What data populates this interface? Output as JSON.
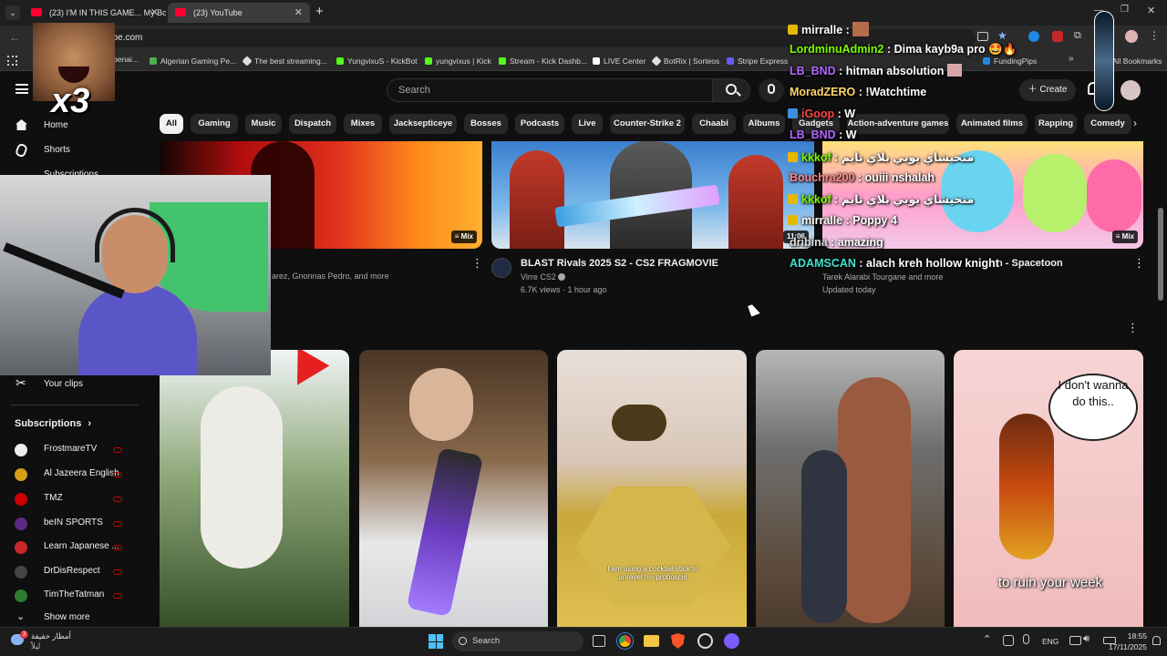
{
  "browser": {
    "tabs": [
      {
        "label": "(23) I'M IN THIS GAME... My Bo",
        "active": false
      },
      {
        "label": "(23) YouTube",
        "active": true
      }
    ],
    "new_tab": "+",
    "url": "ube.com",
    "bookmarks": [
      {
        "label": "Algerian Gaming Pe...",
        "color": "#4caf50"
      },
      {
        "label": "The best streaming...",
        "color": "#dddddd"
      },
      {
        "label": "YungvixuS - KickBot",
        "color": "#53fc18"
      },
      {
        "label": "yungvixus | Kick",
        "color": "#53fc18"
      },
      {
        "label": "Stream - Kick Dashb...",
        "color": "#53fc18"
      },
      {
        "label": "LIVE Center",
        "color": "#ffffff"
      },
      {
        "label": "BotRix | Sorteos",
        "color": "#e0e0e0"
      },
      {
        "label": "Stripe Express",
        "color": "#635bff"
      },
      {
        "label": "FundingPips",
        "color": "#1e88e5"
      },
      {
        "label": "All Bookmarks",
        "color": "#888888"
      }
    ],
    "bm_partial": "benai..."
  },
  "youtube": {
    "search_placeholder": "Search",
    "create_label": "Create",
    "chips": [
      "All",
      "Gaming",
      "Music",
      "Dispatch",
      "Mixes",
      "Jacksepticeye",
      "Bosses",
      "Podcasts",
      "Live",
      "Counter-Strike 2",
      "Chaabi",
      "Albums",
      "Gadgets",
      "Action-adventure games",
      "Animated films",
      "Rapping",
      "Comedy"
    ],
    "sidebar": {
      "home": "Home",
      "shorts": "Shorts",
      "subscriptions_top": "Subscriptions",
      "your_clips": "Your clips",
      "subscriptions_header": "Subscriptions",
      "channels": [
        {
          "name": "FrostmareTV",
          "color": "#eeeeee"
        },
        {
          "name": "Al Jazeera English",
          "color": "#d4a017"
        },
        {
          "name": "TMZ",
          "color": "#cc0000"
        },
        {
          "name": "beIN SPORTS",
          "color": "#5b2a86"
        },
        {
          "name": "Learn Japanese ...",
          "color": "#c62828"
        },
        {
          "name": "DrDisRespect",
          "color": "#444444"
        },
        {
          "name": "TimTheTatman",
          "color": "#2e7d32"
        }
      ],
      "show_more": "Show more"
    },
    "videos_row1": [
      {
        "badge": "Mix",
        "meta": "arez, Gnonnas Pedro, and more"
      },
      {
        "title": "BLAST Rivals 2025 S2 - CS2 FRAGMOVIE",
        "channel": "Virre CS2",
        "views": "6.7K views · 1 hour ago",
        "duration": "11:06"
      },
      {
        "badge": "Mix",
        "title_tail": "n - Spacetoon",
        "meta": "Tarek Alarabi Tourgane and more",
        "updated": "Updated today"
      }
    ],
    "shorts": [
      {
        "caption": ""
      },
      {
        "caption": ""
      },
      {
        "caption": "I am using a cocktail stick to unravel his proboscis"
      },
      {
        "caption": ""
      },
      {
        "caption": "to ruin your week",
        "bubble": "I don't wanna do this.."
      }
    ]
  },
  "chat": [
    {
      "user": "mirralle",
      "msg": " : ",
      "color": "#ffffff",
      "badge": true
    },
    {
      "user": "LordminuAdmin2",
      "msg": " : Dima kayb9a pro",
      "color": "#7cfc00",
      "badge": false
    },
    {
      "user": "LB_BND",
      "msg": " : hitman absolution",
      "color": "#b266ff",
      "badge": false
    },
    {
      "user": "MoradZERO",
      "msg": " : !Watchtime",
      "color": "#ffd966",
      "badge": false
    },
    {
      "user": "iGoop",
      "msg": " : W",
      "color": "#ff4444",
      "badge": true
    },
    {
      "user": "LB_BND",
      "msg": " : W",
      "color": "#b266ff",
      "badge": false
    },
    {
      "user": "kkkof",
      "msg": " : متحيشاي يوبي بلاي تايم",
      "color": "#7cfc00",
      "badge": true
    },
    {
      "user": "Bouchra200",
      "msg": " : ouiii nshalah",
      "color": "#ff8a8a",
      "badge": false
    },
    {
      "user": "kkkof",
      "msg": " : متحيشاي يوبي بلاي تايم",
      "color": "#7cfc00",
      "badge": true
    },
    {
      "user": "mirralle",
      "msg": " : Poppy 4",
      "color": "#ffffff",
      "badge": true
    },
    {
      "user": "dribina",
      "msg": " : amazing",
      "color": "#dddddd",
      "badge": false
    },
    {
      "user": "ADAMSCAN",
      "msg": " : alach kreh hollow knight",
      "color": "#40e0d0",
      "badge": false
    }
  ],
  "overlay": {
    "x3": "x3"
  },
  "taskbar": {
    "search": "Search",
    "notif_count": "3",
    "weather_line1": "أمطار خفيفة",
    "weather_line2": "ليلاً",
    "lang": "ENG",
    "time": "18:55",
    "date": "17/11/2025"
  }
}
